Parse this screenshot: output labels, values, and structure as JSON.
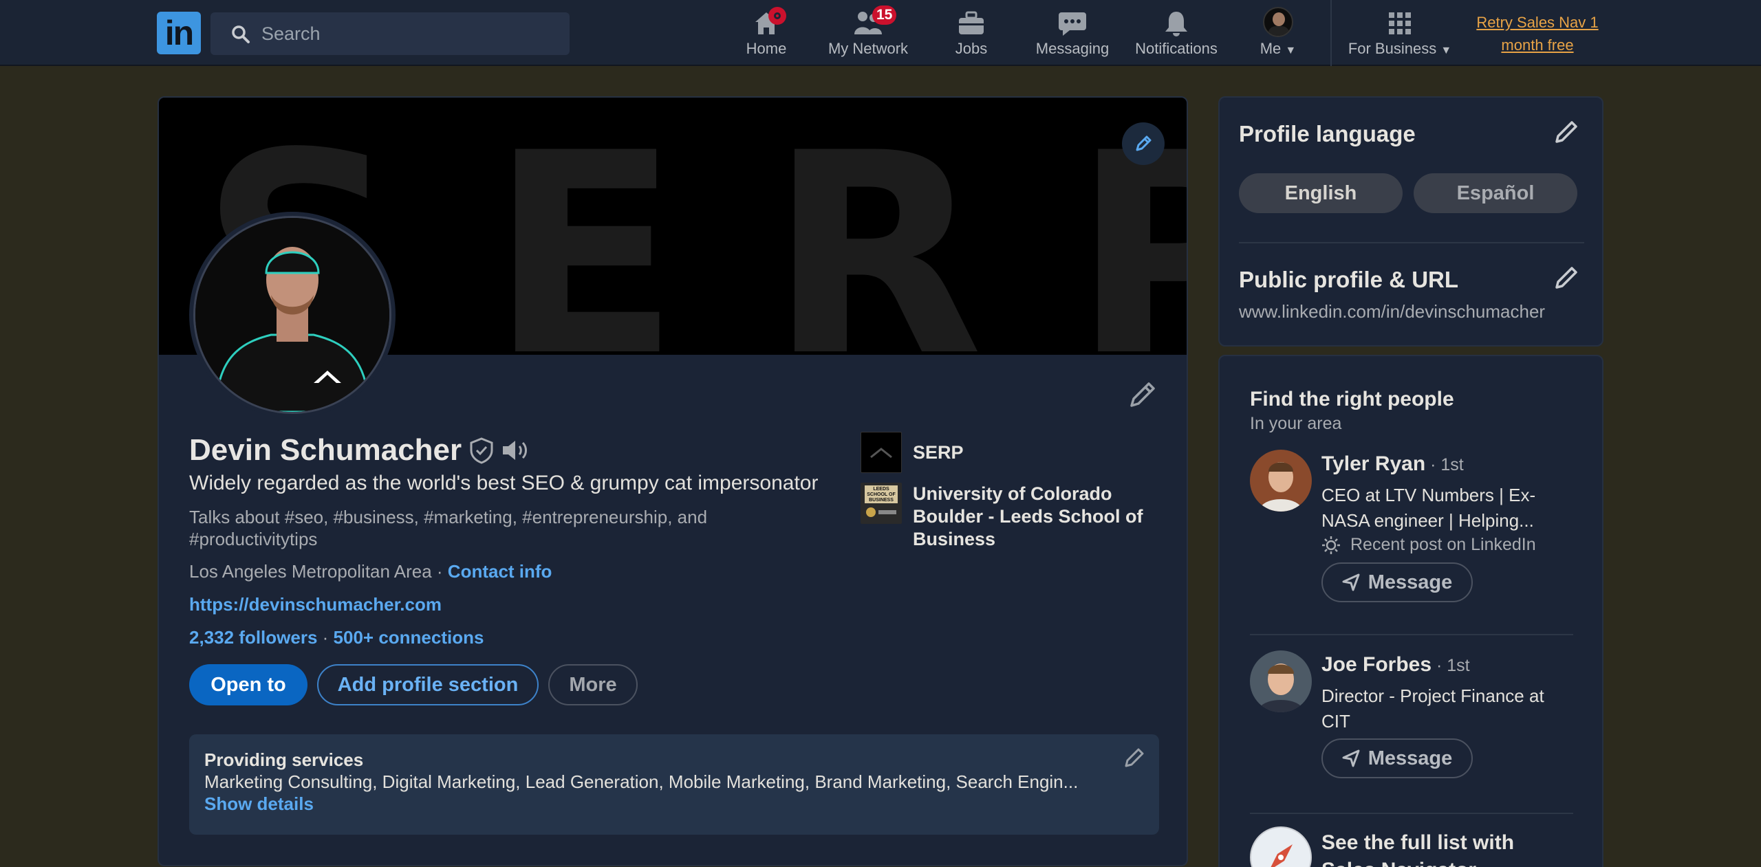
{
  "nav": {
    "logo": "in",
    "search_placeholder": "Search",
    "items": [
      {
        "label": "Home",
        "badge": ""
      },
      {
        "label": "My Network",
        "badge": "15"
      },
      {
        "label": "Jobs",
        "badge": ""
      },
      {
        "label": "Messaging",
        "badge": ""
      },
      {
        "label": "Notifications",
        "badge": ""
      },
      {
        "label": "Me",
        "badge": ""
      },
      {
        "label": "For Business",
        "badge": ""
      }
    ],
    "promo_line1": "Retry Sales Nav 1",
    "promo_line2": "month free"
  },
  "profile": {
    "banner_text": "SERP",
    "name": "Devin Schumacher",
    "headline": "Widely regarded as the world's best SEO & grumpy cat impersonator",
    "talks_about": "Talks about #seo, #business, #marketing, #entrepreneurship, and #productivitytips",
    "location": "Los Angeles Metropolitan Area",
    "location_sep": " · ",
    "contact_info": "Contact info",
    "website": "https://devinschumacher.com",
    "followers": "2,332 followers",
    "conn_sep": " · ",
    "connections": "500+ connections",
    "buttons": {
      "open_to": "Open to",
      "add_section": "Add profile section",
      "more": "More"
    },
    "orgs": [
      {
        "name": "SERP"
      },
      {
        "name": "University of Colorado Boulder - Leeds School of Business",
        "logo_text": "LEEDS SCHOOL OF BUSINESS"
      }
    ],
    "services": {
      "title": "Providing services",
      "list": "Marketing Consulting, Digital Marketing, Lead Generation, Mobile Marketing, Brand Marketing, Search Engin...",
      "show_details": "Show details"
    }
  },
  "rail": {
    "lang_title": "Profile language",
    "lang_options": [
      "English",
      "Español"
    ],
    "url_title": "Public profile & URL",
    "url": "www.linkedin.com/in/devinschumacher",
    "people_title": "Find the right people",
    "people_sub": "In your area",
    "people": [
      {
        "name": "Tyler Ryan",
        "degree": " · 1st",
        "title": "CEO at LTV Numbers | Ex-NASA engineer | Helping...",
        "recent": "Recent post on LinkedIn",
        "action": "Message"
      },
      {
        "name": "Joe Forbes",
        "degree": " · 1st",
        "title": "Director - Project Finance at CIT",
        "recent": "",
        "action": "Message"
      }
    ],
    "sales_nav": "See the full list with Sales Navigator"
  },
  "colors": {
    "accent": "#0a66c2",
    "link": "#5aa9f0",
    "promo": "#e8a346",
    "badge": "#cb112d"
  }
}
